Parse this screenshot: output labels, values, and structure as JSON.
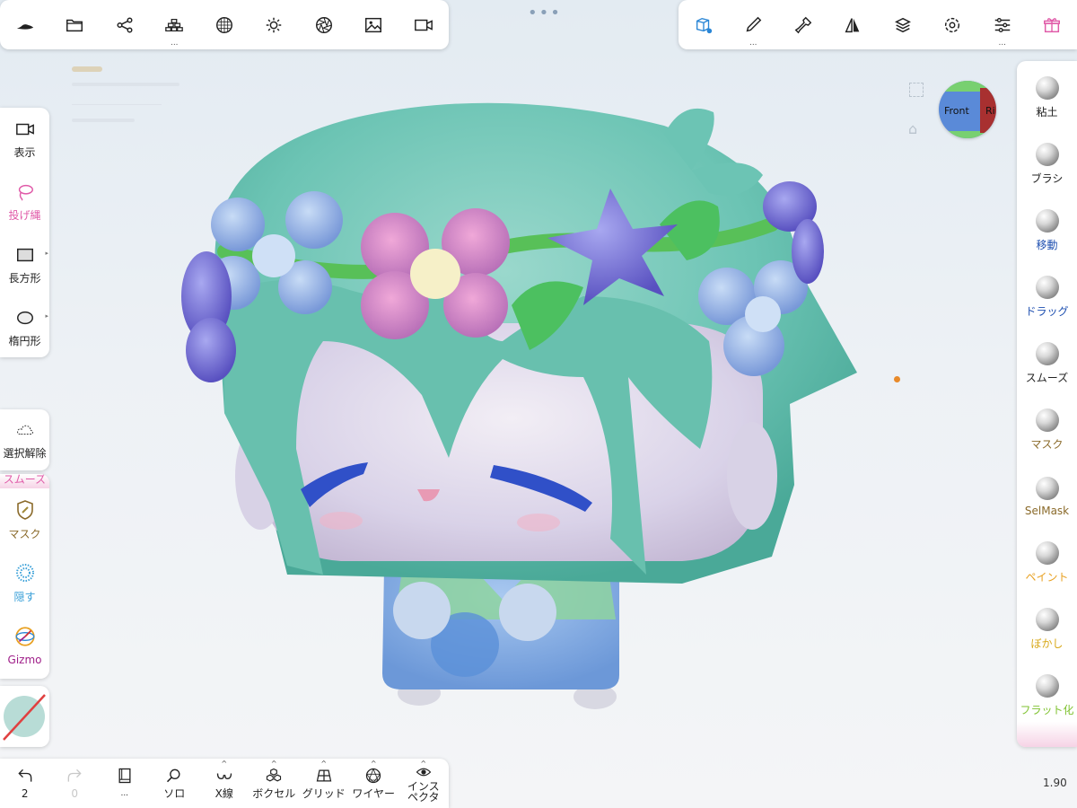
{
  "colors": {
    "accent": "#2a86d6",
    "pink": "#e05aa8",
    "brown": "#8a6a2a",
    "mask_gold": "#a08a3a",
    "paint_orange": "#e8a020",
    "blur_yellow": "#d8a818",
    "flat_green": "#7fc230",
    "move_blue": "#1e4fb0",
    "gizmo_purple": "#a0208a",
    "hide_blue": "#3aa0d8"
  },
  "top_left_toolbar": [
    "hat-icon",
    "folder-icon",
    "scene-graph-icon",
    "voxel-stack-icon",
    "material-sphere-icon",
    "light-icon",
    "shutter-icon",
    "image-icon",
    "video-icon"
  ],
  "top_right_toolbar": [
    "transform-tool-icon",
    "brush-icon",
    "stamp-icon",
    "symmetry-icon",
    "layers-icon",
    "settings-icon",
    "sliders-icon",
    "gift-icon"
  ],
  "left_panel_1": [
    {
      "label": "表示",
      "icon": "camera-icon"
    },
    {
      "label": "投げ縄",
      "icon": "lasso-icon"
    },
    {
      "label": "長方形",
      "icon": "rectangle-icon"
    },
    {
      "label": "楕円形",
      "icon": "ellipse-icon"
    }
  ],
  "left_panel_2": {
    "label": "選択解除",
    "icon": "cloud-icon"
  },
  "left_panel_3": {
    "top_label": "スムーズ",
    "items": [
      {
        "label": "マスク",
        "icon": "mask-shield-icon"
      },
      {
        "label": "隠す",
        "icon": "hide-dots-icon"
      },
      {
        "label": "Gizmo",
        "icon": "gizmo-icon"
      }
    ]
  },
  "right_tools": [
    {
      "label": "粘土",
      "color": "#222222"
    },
    {
      "label": "ブラシ",
      "color": "#222222"
    },
    {
      "label": "移動",
      "color": "#1e4fb0"
    },
    {
      "label": "ドラッグ",
      "color": "#1e4fb0"
    },
    {
      "label": "スムーズ",
      "color": "#222222"
    },
    {
      "label": "マスク",
      "color": "#8a6a2a"
    },
    {
      "label": "SelMask",
      "color": "#8a6a2a"
    },
    {
      "label": "ペイント",
      "color": "#e8a020"
    },
    {
      "label": "ぼかし",
      "color": "#d8a818"
    },
    {
      "label": "フラット化",
      "color": "#7fc230"
    }
  ],
  "bottom_bar": [
    {
      "label": "2",
      "icon": "undo-icon"
    },
    {
      "label": "0",
      "icon": "redo-icon"
    },
    {
      "label": "...",
      "icon": "book-icon"
    },
    {
      "label": "ソロ",
      "icon": "search-icon"
    },
    {
      "label": "X線",
      "icon": "xray-glasses-icon"
    },
    {
      "label": "ボクセル",
      "icon": "voxel-icon"
    },
    {
      "label": "グリッド",
      "icon": "grid-icon"
    },
    {
      "label": "ワイヤー",
      "icon": "wire-icon"
    },
    {
      "label": "インスペクタ",
      "icon": "inspector-eye-icon"
    }
  ],
  "view_cube": {
    "front_label": "Front",
    "right_label": "Ri"
  },
  "zoom_level": "1.90"
}
